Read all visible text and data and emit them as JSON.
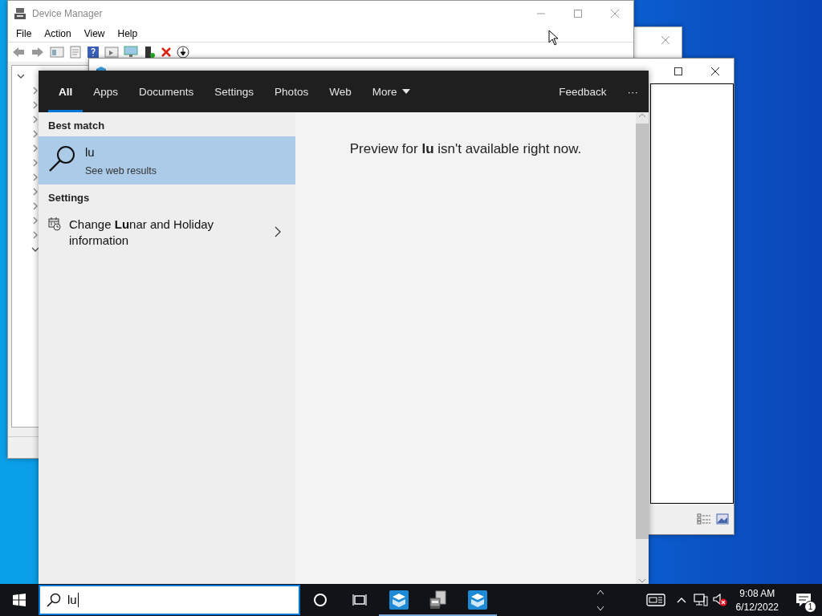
{
  "windows": [
    {
      "kind": "backdrop"
    },
    {
      "kind": "device_manager",
      "title": "Device Manager",
      "menu": [
        "File",
        "Action",
        "View",
        "Help"
      ],
      "tree": {
        "expanded": true,
        "children": [
          {
            "expanded": false
          },
          {
            "expanded": false
          },
          {
            "expanded": false
          },
          {
            "expanded": false
          },
          {
            "expanded": false
          },
          {
            "expanded": false
          },
          {
            "expanded": false
          },
          {
            "expanded": false
          },
          {
            "expanded": false
          },
          {
            "expanded": false
          },
          {
            "expanded": false
          },
          {
            "expanded": true
          }
        ]
      }
    },
    {
      "kind": "sandbox"
    }
  ],
  "search": {
    "tabs": [
      {
        "label": "All",
        "selected": true
      },
      {
        "label": "Apps",
        "selected": false
      },
      {
        "label": "Documents",
        "selected": false
      },
      {
        "label": "Settings",
        "selected": false
      },
      {
        "label": "Photos",
        "selected": false
      },
      {
        "label": "Web",
        "selected": false
      },
      {
        "label": "More",
        "selected": false,
        "kind": "menu"
      }
    ],
    "feedback": "Feedback",
    "more_options": "···",
    "sections": [
      {
        "heading": "Best match",
        "items": [
          {
            "kind": "web",
            "title": "lu",
            "subtitle": "See web results",
            "selected": true
          }
        ]
      },
      {
        "heading": "Settings",
        "items": [
          {
            "kind": "setting",
            "title": "Change **Lu**nar and Holiday information",
            "selected": false
          }
        ]
      }
    ],
    "preview": "Preview for **lu** isn't available right now.",
    "query": "lu"
  },
  "taskbar": {
    "apps": [
      {
        "kind": "sandbox",
        "running": true
      },
      {
        "kind": "device_manager",
        "running": true
      },
      {
        "kind": "sandbox",
        "running": true
      }
    ],
    "time": "9:08 AM",
    "date": "6/12/2022",
    "notifications": "1"
  }
}
